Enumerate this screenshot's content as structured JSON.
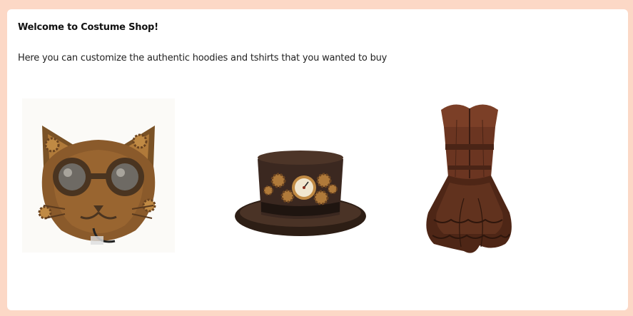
{
  "welcome": {
    "title": "Welcome to Costume Shop!",
    "subtitle": "Here you can customize the authentic hoodies and tshirts that you wanted to buy"
  },
  "products": [
    {
      "name": "steampunk-cat-mask",
      "icon": "cat-mask-image"
    },
    {
      "name": "steampunk-top-hat",
      "icon": "top-hat-image"
    },
    {
      "name": "steampunk-corset-dress",
      "icon": "corset-dress-image"
    }
  ],
  "colors": {
    "page_background": "#fcd8c6",
    "card_background": "#ffffff",
    "bronze": "#8a5a2b",
    "dark_brown": "#3b2418",
    "leather": "#6b3a24"
  }
}
